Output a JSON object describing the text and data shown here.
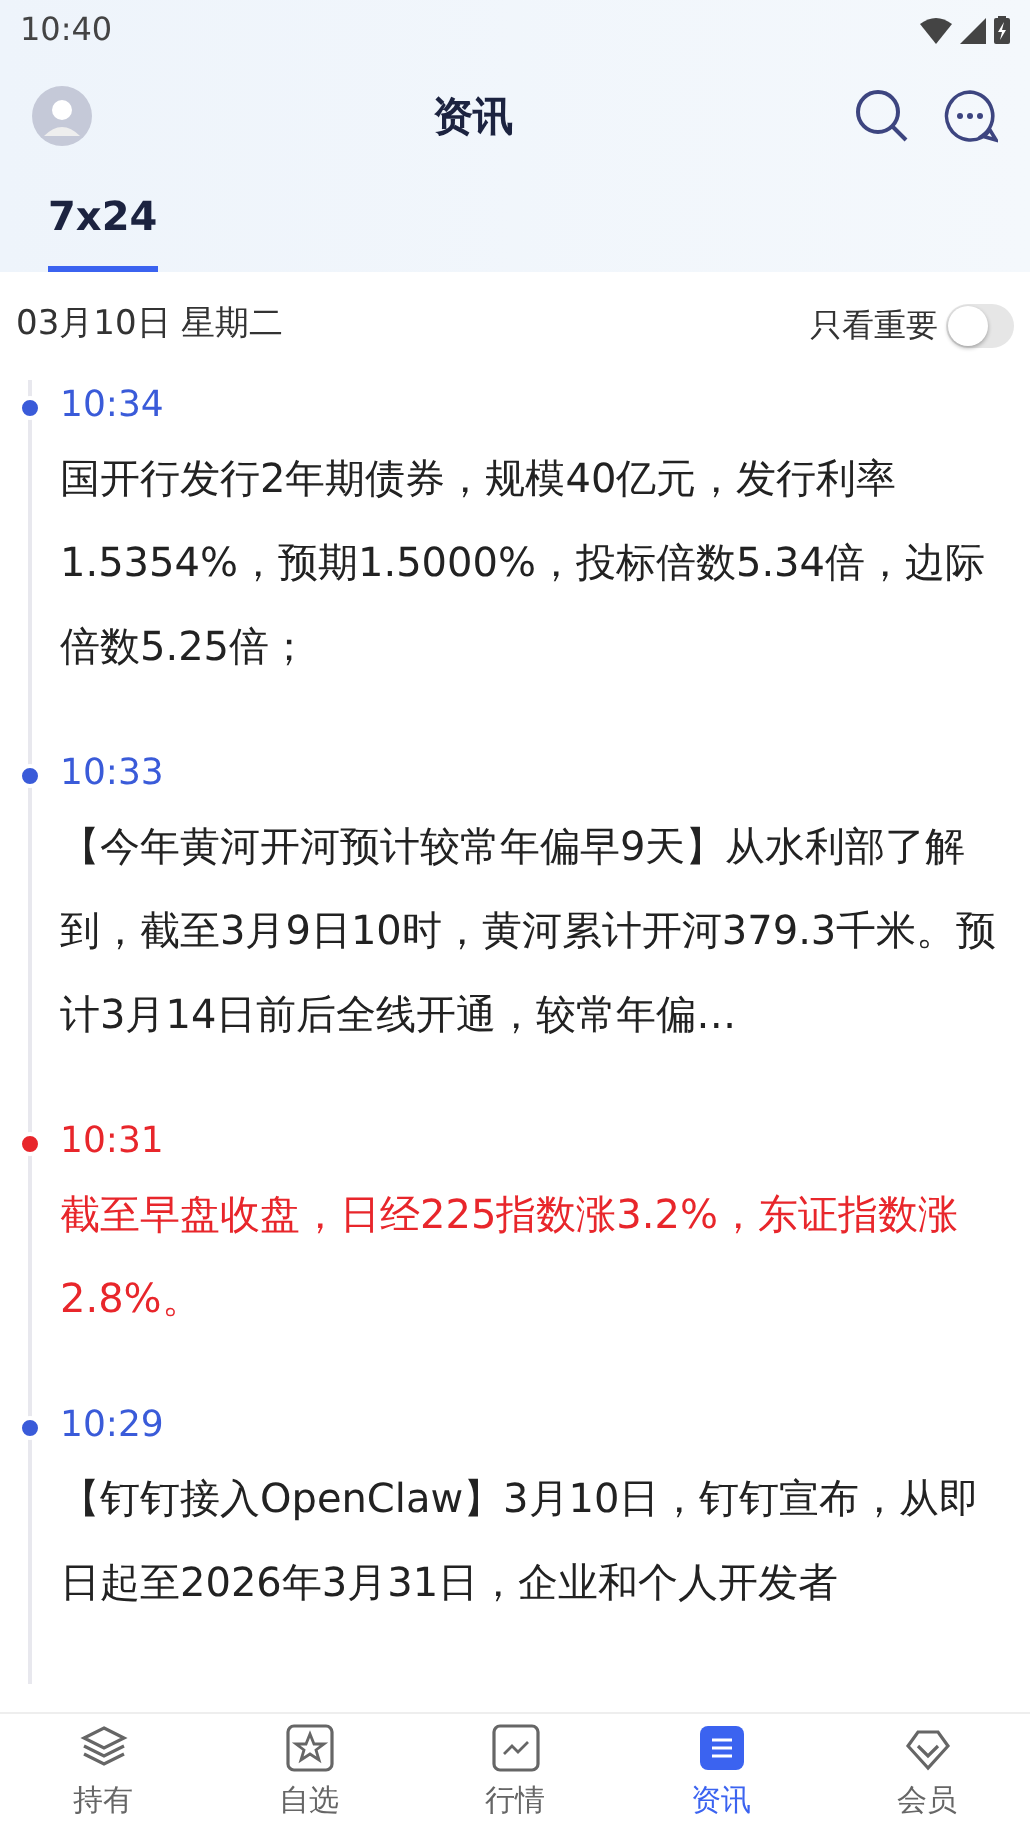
{
  "status_bar": {
    "time": "10:40"
  },
  "header": {
    "title": "资讯"
  },
  "tabs": [
    {
      "label": "7x24",
      "selected": true
    }
  ],
  "date_row": {
    "date": "03月10日 星期二",
    "filter_label": "只看重要",
    "filter_on": false
  },
  "news": [
    {
      "time": "10:34",
      "important": false,
      "text": "国开行发行2年期债券，规模40亿元，发行利率1.5354%，预期1.5000%，投标倍数5.34倍，边际倍数5.25倍；"
    },
    {
      "time": "10:33",
      "important": false,
      "text": "【今年黄河开河预计较常年偏早9天】从水利部了解到，截至3月9日10时，黄河累计开河379.3千米。预计3月14日前后全线开通，较常年偏…"
    },
    {
      "time": "10:31",
      "important": true,
      "text": "截至早盘收盘，日经225指数涨3.2%，东证指数涨2.8%。"
    },
    {
      "time": "10:29",
      "important": false,
      "text": "【钉钉接入OpenClaw】3月10日，钉钉宣布，从即日起至2026年3月31日，企业和个人开发者"
    }
  ],
  "bottom_nav": [
    {
      "label": "持有",
      "selected": false
    },
    {
      "label": "自选",
      "selected": false
    },
    {
      "label": "行情",
      "selected": false
    },
    {
      "label": "资讯",
      "selected": true
    },
    {
      "label": "会员",
      "selected": false
    }
  ]
}
